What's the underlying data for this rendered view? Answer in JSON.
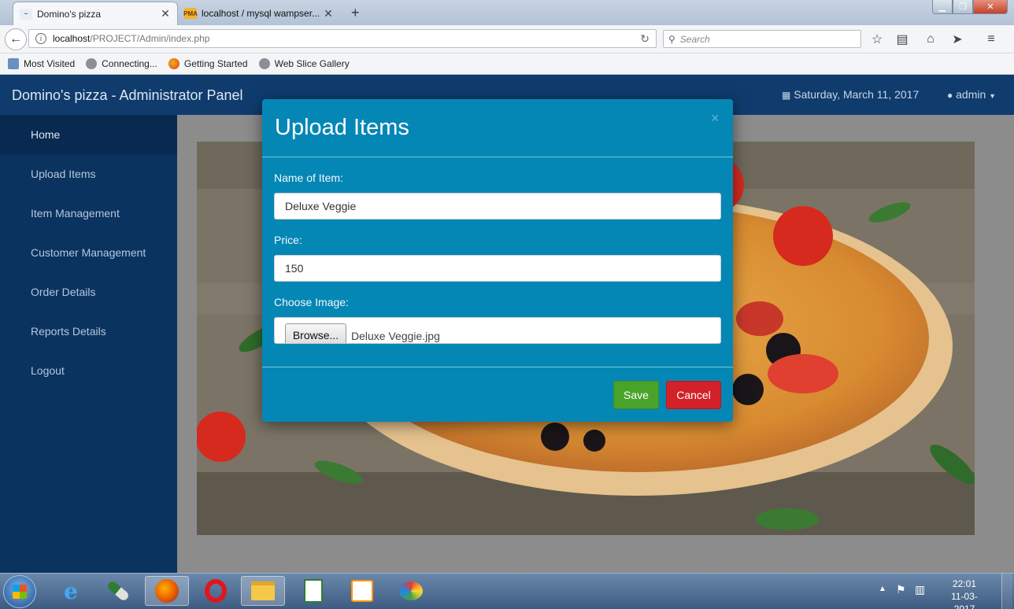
{
  "browser": {
    "tabs": [
      {
        "label": "Domino's pizza",
        "active": true
      },
      {
        "label": "localhost / mysql wampser...",
        "active": false,
        "favicon_text": "PMA"
      }
    ],
    "url_host": "localhost",
    "url_path": "/PROJECT/Admin/index.php",
    "search_placeholder": "Search",
    "bookmarks": [
      "Most Visited",
      "Connecting...",
      "Getting Started",
      "Web Slice Gallery"
    ]
  },
  "app": {
    "title": "Domino's pizza - Administrator Panel",
    "date": "Saturday, March 11, 2017",
    "user": "admin",
    "header_color": "#0f3c6d"
  },
  "sidebar": {
    "items": [
      {
        "label": "Home",
        "active": true
      },
      {
        "label": "Upload Items"
      },
      {
        "label": "Item Management"
      },
      {
        "label": "Customer Management"
      },
      {
        "label": "Order Details"
      },
      {
        "label": "Reports Details"
      },
      {
        "label": "Logout"
      }
    ]
  },
  "modal": {
    "title": "Upload Items",
    "close_glyph": "×",
    "name_label": "Name of Item:",
    "name_value": "Deluxe Veggie",
    "price_label": "Price:",
    "price_value": "150",
    "image_label": "Choose Image:",
    "browse_label": "Browse...",
    "file_name": "Deluxe Veggie.jpg",
    "save_label": "Save",
    "cancel_label": "Cancel",
    "accent_color": "#0587b5"
  },
  "taskbar": {
    "time": "22:01",
    "date": "11-03-2017"
  }
}
